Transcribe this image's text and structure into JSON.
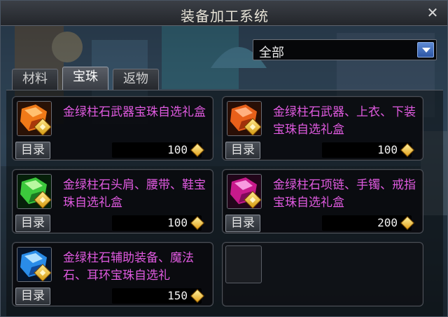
{
  "window": {
    "title": "装备加工系统"
  },
  "filter": {
    "selected": "全部"
  },
  "tabs": [
    {
      "label": "材料",
      "active": false
    },
    {
      "label": "宝珠",
      "active": true
    },
    {
      "label": "返物",
      "active": false
    }
  ],
  "items": [
    {
      "name": "金绿柱石武器宝珠自选礼盒",
      "price": "100",
      "catalog_label": "目录",
      "gem_color": "#f07a18",
      "icon": "orange-gem-icon"
    },
    {
      "name": "金绿柱石武器、上衣、下装宝珠自选礼盒",
      "price": "100",
      "catalog_label": "目录",
      "gem_color": "#e8601a",
      "icon": "orange-gem-icon"
    },
    {
      "name": "金绿柱石头肩、腰带、鞋宝珠自选礼盒",
      "price": "100",
      "catalog_label": "目录",
      "gem_color": "#3cc83c",
      "icon": "green-gem-icon"
    },
    {
      "name": "金绿柱石项链、手镯、戒指宝珠自选礼盒",
      "price": "200",
      "catalog_label": "目录",
      "gem_color": "#c81a8c",
      "icon": "magenta-gem-icon"
    },
    {
      "name": "金绿柱石辅助装备、魔法石、耳环宝珠自选礼",
      "price": "150",
      "catalog_label": "目录",
      "gem_color": "#2a8ce8",
      "icon": "blue-gem-icon"
    }
  ],
  "colors": {
    "item_name": "#e05ae0",
    "accent_blue": "#2d56a4",
    "coin_gold": "#e4a21a"
  }
}
